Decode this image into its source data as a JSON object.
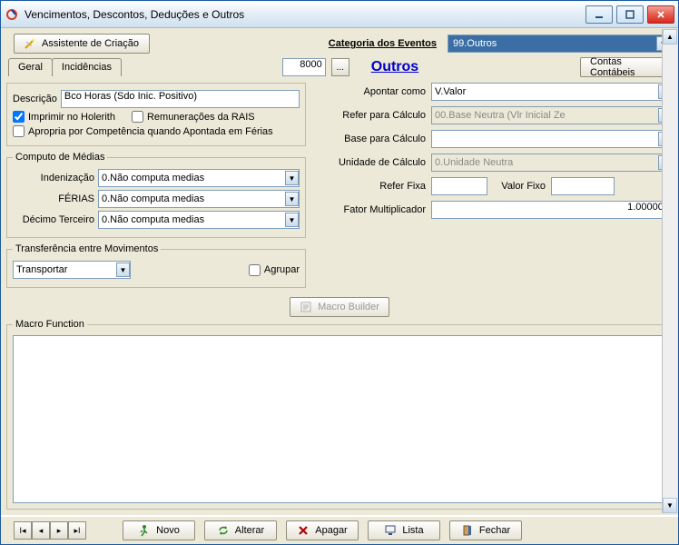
{
  "window": {
    "title": "Vencimentos, Descontos, Deduções e Outros"
  },
  "toolbar": {
    "assist": "Assistente de Criação",
    "cat_label": "Categoria dos Eventos",
    "cat_value": "99.Outros"
  },
  "tabs": {
    "geral": "Geral",
    "incid": "Incidências"
  },
  "code": {
    "value": "8000",
    "browse": "..."
  },
  "link": {
    "outros": "Outros"
  },
  "buttons": {
    "contas": "Contas Contábeis",
    "macro_builder": "Macro Builder"
  },
  "desc": {
    "descricao_label": "Descrição",
    "descricao_value": "Bco Horas (Sdo Inic. Positivo)",
    "imprimir": "Imprimir no Holerith",
    "remun_rais": "Remunerações da RAIS",
    "apropria": "Apropria por Competência quando Apontada em Férias"
  },
  "medias": {
    "legend": "Computo de Médias",
    "indenizacao": "Indenização",
    "ferias": "FÉRIAS",
    "decimo": "Décimo Terceiro",
    "val": "0.Não computa medias"
  },
  "transf": {
    "legend": "Transferência entre Movimentos",
    "transportar": "Transportar",
    "agrupar": "Agrupar"
  },
  "right": {
    "apontar": "Apontar como",
    "apontar_val": "V.Valor",
    "refer_calc": "Refer para Cálculo",
    "refer_calc_val": "00.Base Neutra (Vlr Inicial Ze",
    "base_calc": "Base para Cálculo",
    "base_calc_val": "",
    "unidade": "Unidade de Cálculo",
    "unidade_val": "0.Unidade Neutra",
    "refer_fixa": "Refer Fixa",
    "refer_fixa_val": "",
    "valor_fixo": "Valor Fixo",
    "valor_fixo_val": "",
    "fator": "Fator Multiplicador",
    "fator_val": "1.000000"
  },
  "macro": {
    "legend": "Macro Function"
  },
  "footer": {
    "novo": "Novo",
    "alterar": "Alterar",
    "apagar": "Apagar",
    "lista": "Lista",
    "fechar": "Fechar"
  }
}
